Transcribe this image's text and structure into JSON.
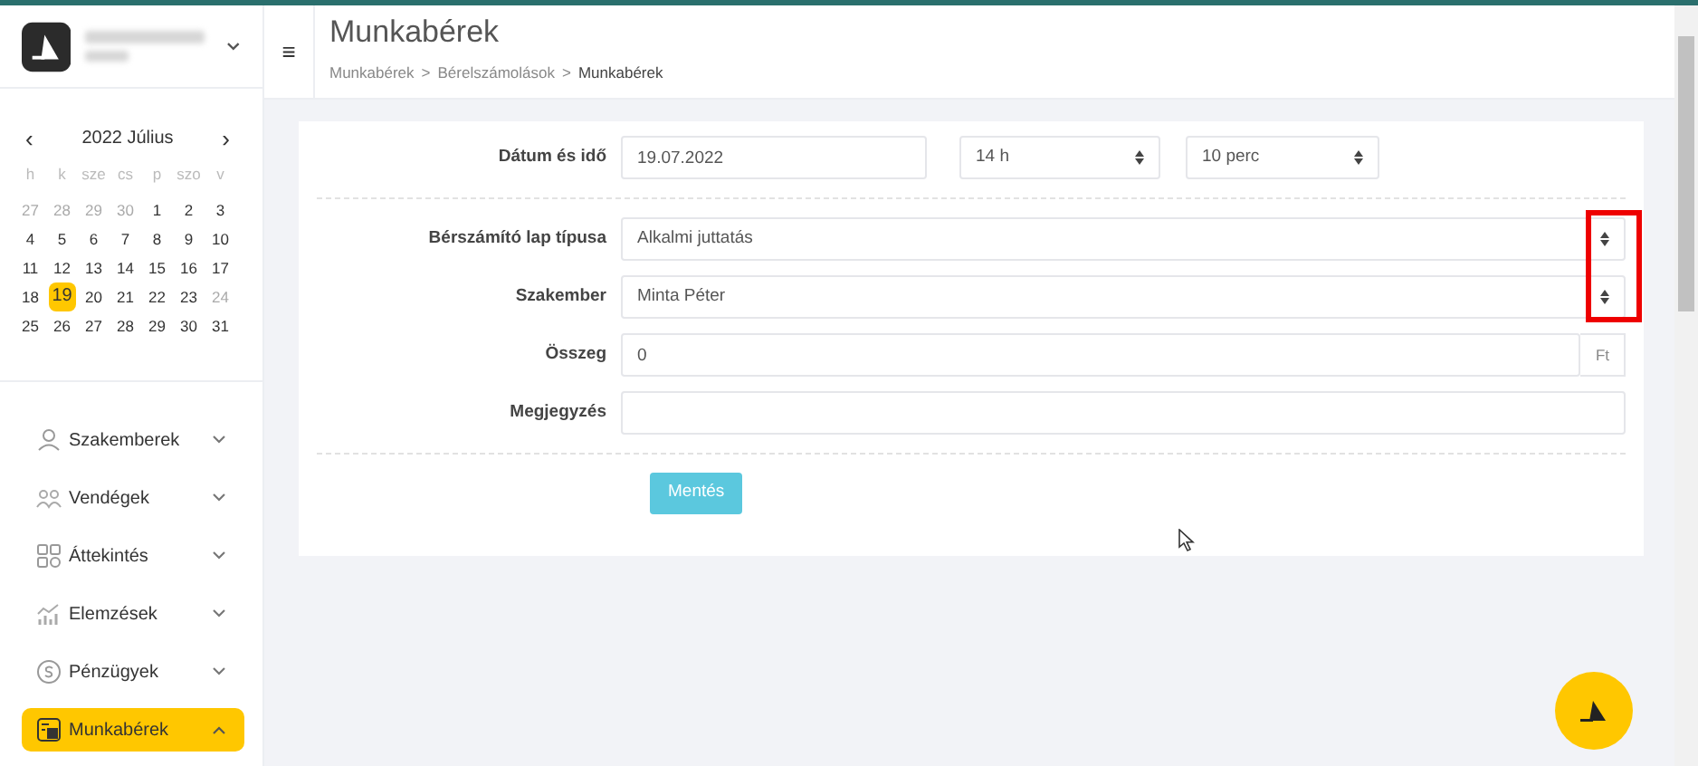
{
  "calendar": {
    "title": "2022 Július",
    "prev": "‹",
    "next": "›",
    "weekdays": [
      "h",
      "k",
      "sze",
      "cs",
      "p",
      "szo",
      "v"
    ],
    "weeks": [
      [
        {
          "day": "27",
          "muted": true,
          "selected": false
        },
        {
          "day": "28",
          "muted": true,
          "selected": false
        },
        {
          "day": "29",
          "muted": true,
          "selected": false
        },
        {
          "day": "30",
          "muted": true,
          "selected": false
        },
        {
          "day": "1",
          "muted": false,
          "selected": false
        },
        {
          "day": "2",
          "muted": false,
          "selected": false
        },
        {
          "day": "3",
          "muted": false,
          "selected": false
        }
      ],
      [
        {
          "day": "4",
          "muted": false,
          "selected": false
        },
        {
          "day": "5",
          "muted": false,
          "selected": false
        },
        {
          "day": "6",
          "muted": false,
          "selected": false
        },
        {
          "day": "7",
          "muted": false,
          "selected": false
        },
        {
          "day": "8",
          "muted": false,
          "selected": false
        },
        {
          "day": "9",
          "muted": false,
          "selected": false
        },
        {
          "day": "10",
          "muted": false,
          "selected": false
        }
      ],
      [
        {
          "day": "11",
          "muted": false,
          "selected": false
        },
        {
          "day": "12",
          "muted": false,
          "selected": false
        },
        {
          "day": "13",
          "muted": false,
          "selected": false
        },
        {
          "day": "14",
          "muted": false,
          "selected": false
        },
        {
          "day": "15",
          "muted": false,
          "selected": false
        },
        {
          "day": "16",
          "muted": false,
          "selected": false
        },
        {
          "day": "17",
          "muted": false,
          "selected": false
        }
      ],
      [
        {
          "day": "18",
          "muted": false,
          "selected": false
        },
        {
          "day": "19",
          "muted": false,
          "selected": true
        },
        {
          "day": "20",
          "muted": false,
          "selected": false
        },
        {
          "day": "21",
          "muted": false,
          "selected": false
        },
        {
          "day": "22",
          "muted": false,
          "selected": false
        },
        {
          "day": "23",
          "muted": false,
          "selected": false
        },
        {
          "day": "24",
          "muted": true,
          "selected": false
        }
      ],
      [
        {
          "day": "25",
          "muted": false,
          "selected": false
        },
        {
          "day": "26",
          "muted": false,
          "selected": false
        },
        {
          "day": "27",
          "muted": false,
          "selected": false
        },
        {
          "day": "28",
          "muted": false,
          "selected": false
        },
        {
          "day": "29",
          "muted": false,
          "selected": false
        },
        {
          "day": "30",
          "muted": false,
          "selected": false
        },
        {
          "day": "31",
          "muted": false,
          "selected": false
        }
      ]
    ]
  },
  "sidebar": {
    "items": [
      {
        "label": "Szakemberek",
        "kind": "person",
        "selected": false,
        "expanded": false
      },
      {
        "label": "Vendégek",
        "kind": "group",
        "selected": false,
        "expanded": false
      },
      {
        "label": "Áttekintés",
        "kind": "grid",
        "selected": false,
        "expanded": false
      },
      {
        "label": "Elemzések",
        "kind": "chart",
        "selected": false,
        "expanded": false
      },
      {
        "label": "Pénzügyek",
        "kind": "coin",
        "selected": false,
        "expanded": false
      },
      {
        "label": "Munkabérek",
        "kind": "payroll",
        "selected": true,
        "expanded": true
      }
    ]
  },
  "header": {
    "menu": "≡",
    "title": "Munkabérek",
    "breadcrumb": [
      {
        "label": "Munkabérek",
        "current": false
      },
      {
        "label": "Bérelszámolások",
        "current": false
      },
      {
        "label": "Munkabérek",
        "current": true
      }
    ],
    "separator": ">"
  },
  "form": {
    "rows": [
      {
        "label": "Dátum és idő",
        "fields": [
          {
            "kind": "input",
            "value": "19.07.2022"
          },
          {
            "kind": "select",
            "value": "14 h"
          },
          {
            "kind": "select",
            "value": "10 perc"
          }
        ],
        "divider_after": true
      },
      {
        "label": "Bérszámító lap típusa",
        "fields": [
          {
            "kind": "select",
            "value": "Alkalmi juttatás"
          }
        ],
        "divider_after": false
      },
      {
        "label": "Szakember",
        "fields": [
          {
            "kind": "select",
            "value": "Minta Péter"
          }
        ],
        "divider_after": false
      },
      {
        "label": "Összeg",
        "fields": [
          {
            "kind": "input",
            "value": "0",
            "addon": "Ft"
          }
        ],
        "divider_after": false
      },
      {
        "label": "Megjegyzés",
        "fields": [
          {
            "kind": "input"
          }
        ],
        "divider_after": true
      }
    ],
    "submit": "Mentés"
  }
}
